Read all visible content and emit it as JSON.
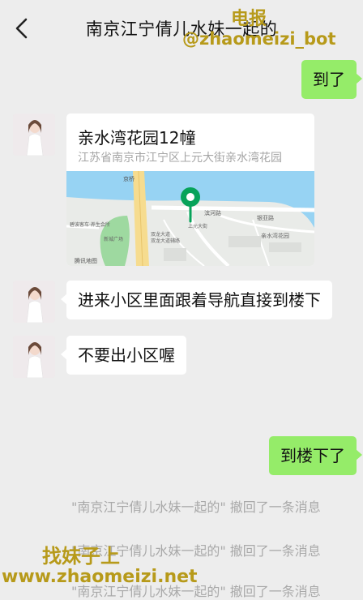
{
  "header": {
    "title": "南京江宁倩儿水妹一起的"
  },
  "watermark": {
    "line1": "电报",
    "line2": "@zhaomeizi_bot",
    "line3": "找妹子上",
    "line4": "www.zhaomeizi.net"
  },
  "messages": {
    "m1": "到了",
    "location_name": "亲水湾花园12幢",
    "location_address": "江苏省南京市江宁区上元大街亲水湾花园",
    "m3": "进来小区里面跟着导航直接到楼下",
    "m4": "不要出小区喔",
    "m5": "到楼下了"
  },
  "map": {
    "labels": [
      "京桥",
      "滨河路",
      "银亚路",
      "亲水湾花园",
      "双龙大道",
      "双龙大道辅路",
      "碧波客车·养生会所",
      "上元大街",
      "新城广场",
      "腾讯地图"
    ]
  },
  "system": {
    "recall1": "\"南京江宁倩儿水妹一起的\" 撤回了一条消息",
    "recall2": "\"南京江宁倩儿水妹一起的\" 撤回了一条消息",
    "recall3": "\"南京江宁倩儿水妹一起的\" 撤回了一条消息"
  },
  "colors": {
    "background": "#ededed",
    "outgoing_bubble": "#95ec69",
    "incoming_bubble": "#ffffff",
    "map_pin": "#07a35a",
    "watermark": "#b79a1a"
  }
}
